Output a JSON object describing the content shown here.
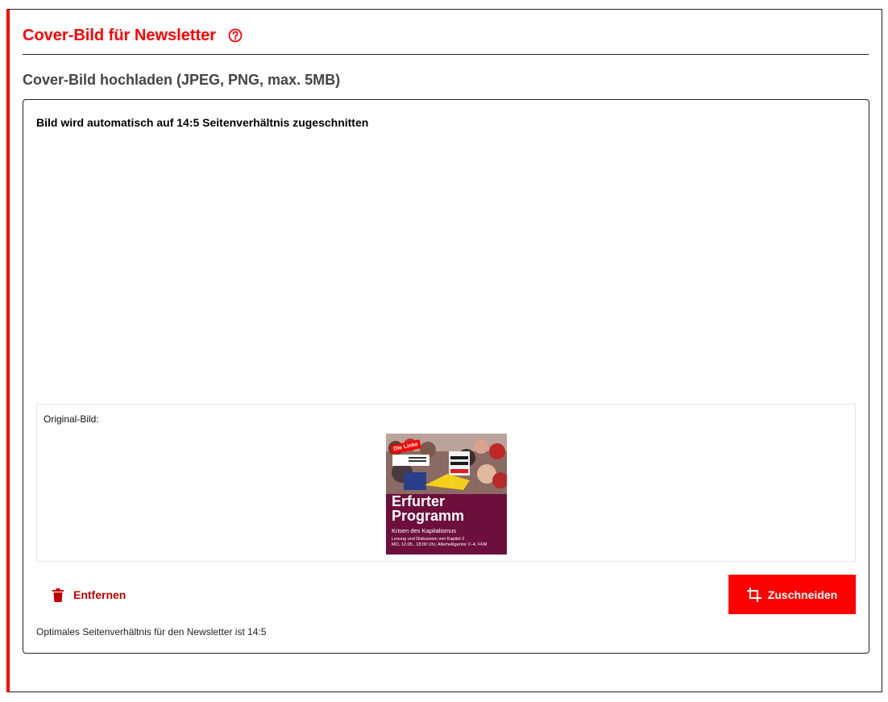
{
  "header": {
    "title": "Cover-Bild für Newsletter",
    "help_icon": "help-circle-icon"
  },
  "upload": {
    "label": "Cover-Bild hochladen (JPEG, PNG, max. 5MB)",
    "crop_note": "Bild wird automatisch auf 14:5 Seitenverhältnis zugeschnitten",
    "original_label": "Original-Bild:",
    "thumbnail": {
      "badge": "Die Linke",
      "title_line1": "Erfurter",
      "title_line2": "Programm",
      "subtitle": "Krisen des Kapitalismus",
      "detail_line1": "Lesung und Diskussion von Kapitel 2",
      "detail_line2": "MO, 12.05., 18:00 Uhr, Allerheiligentor 2–4, FFM"
    },
    "remove_label": "Entfernen",
    "remove_icon": "trash-icon",
    "crop_label": "Zuschneiden",
    "crop_icon": "crop-icon",
    "hint": "Optimales Seitenverhältnis für den Newsletter ist 14:5"
  },
  "colors": {
    "accent": "#ff0000",
    "remove_text": "#c00000",
    "thumbnail_bg": "#6d0f3c"
  }
}
